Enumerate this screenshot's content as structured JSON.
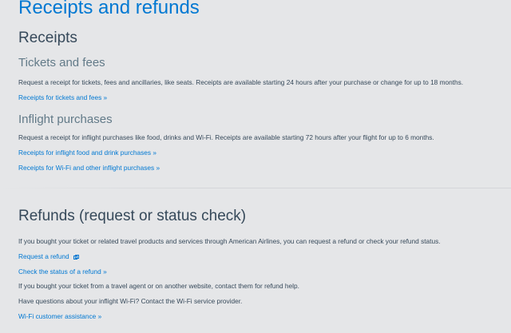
{
  "page_title": "Receipts and refunds",
  "receipts": {
    "heading": "Receipts",
    "tickets": {
      "heading": "Tickets and fees",
      "description": "Request a receipt for tickets, fees and ancillaries, like seats. Receipts are available starting 24 hours after your purchase or change for up to 18 months.",
      "link": "Receipts for tickets and fees »"
    },
    "inflight": {
      "heading": "Inflight purchases",
      "description": "Request a receipt for inflight purchases like food, drinks and Wi-Fi. Receipts are available starting 72 hours after your flight for up to 6 months.",
      "link_food": "Receipts for inflight food and drink purchases »",
      "link_wifi": "Receipts for Wi-Fi and other inflight purchases »"
    }
  },
  "refunds": {
    "heading": "Refunds (request or status check)",
    "description": "If you bought your ticket or related travel products and services through American Airlines, you can request a refund or check your refund status.",
    "link_request": "Request a refund",
    "link_status": "Check the status of a refund »",
    "agent_text": "If you bought your ticket from a travel agent or on another website, contact them for refund help.",
    "wifi_text": "Have questions about your inflight Wi-Fi? Contact the Wi-Fi service provider.",
    "link_wifi": "Wi-Fi customer assistance »"
  },
  "icons": {
    "external": "external-link-icon"
  },
  "colors": {
    "link": "#0078d2",
    "heading": "#36495a",
    "subheading": "#627a88",
    "background": "#e5e6e8"
  }
}
